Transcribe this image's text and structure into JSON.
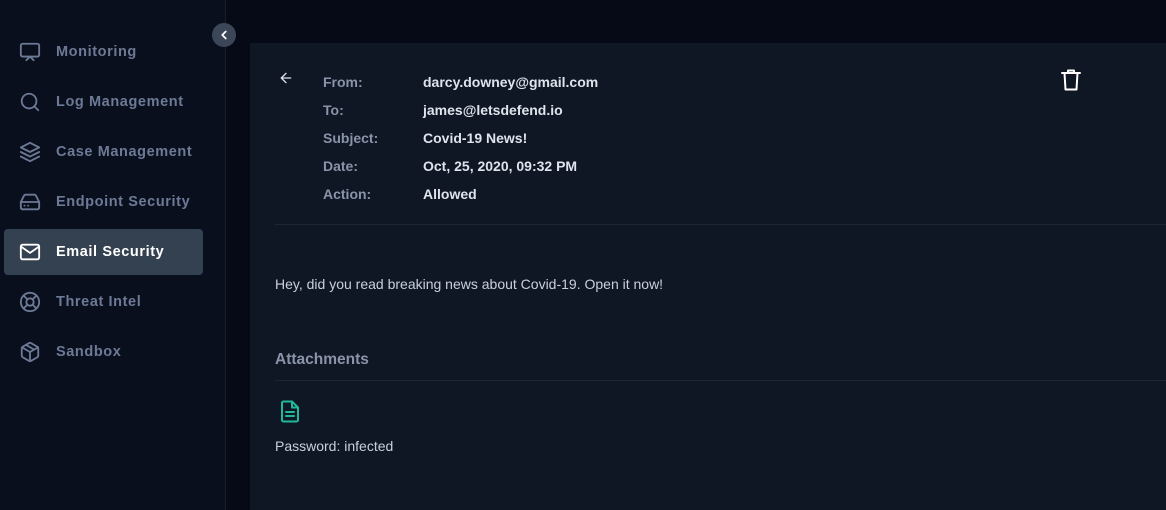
{
  "sidebar": {
    "items": [
      {
        "label": "Monitoring",
        "icon": "monitor-icon"
      },
      {
        "label": "Log Management",
        "icon": "search-icon"
      },
      {
        "label": "Case Management",
        "icon": "layers-icon"
      },
      {
        "label": "Endpoint Security",
        "icon": "hard-drive-icon"
      },
      {
        "label": "Email Security",
        "icon": "mail-icon",
        "active": true
      },
      {
        "label": "Threat Intel",
        "icon": "life-buoy-icon"
      },
      {
        "label": "Sandbox",
        "icon": "package-icon"
      }
    ]
  },
  "email": {
    "from_label": "From:",
    "from": "darcy.downey@gmail.com",
    "to_label": "To:",
    "to": "james@letsdefend.io",
    "subject_label": "Subject:",
    "subject": "Covid-19 News!",
    "date_label": "Date:",
    "date": "Oct, 25, 2020, 09:32 PM",
    "action_label": "Action:",
    "action": "Allowed",
    "body": "Hey, did you read breaking news about Covid-19. Open it now!",
    "attachments_title": "Attachments",
    "attachment_note": "Password: infected"
  },
  "colors": {
    "accent_file": "#20b89a",
    "active_nav": "#344150"
  }
}
